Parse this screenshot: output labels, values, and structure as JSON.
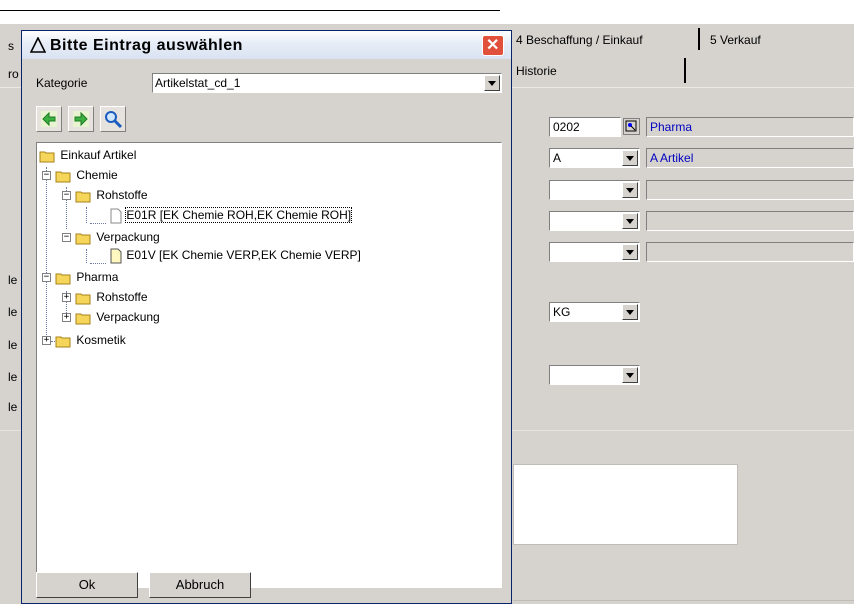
{
  "background": {
    "tabs": [
      {
        "label": "4 Beschaffung / Einkauf"
      },
      {
        "label": "5 Verkauf"
      },
      {
        "label": "Historie"
      }
    ],
    "left_fragments": [
      "s",
      "ro",
      "le",
      "le",
      "le",
      "le",
      "le"
    ],
    "rows": [
      {
        "code": "0202",
        "desc": "Pharma"
      },
      {
        "code": "A",
        "desc": "A Artikel"
      },
      {
        "code": "",
        "desc": ""
      },
      {
        "code": "",
        "desc": ""
      },
      {
        "code": "",
        "desc": ""
      }
    ],
    "unit_value": "KG",
    "empty_combo_value": ""
  },
  "dialog": {
    "title": "Bitte Eintrag auswählen",
    "category_label": "Kategorie",
    "category_value": "Artikelstat_cd_1",
    "toolbar": [
      {
        "icon": "expand-arrow-icon"
      },
      {
        "icon": "collapse-arrow-icon"
      },
      {
        "icon": "search-magnifier-icon"
      }
    ],
    "tree": {
      "root": "Einkauf Artikel",
      "chemie": "Chemie",
      "chemie_rohstoffe": "Rohstoffe",
      "e01r": "E01R [EK Chemie ROH,EK Chemie ROH]",
      "chemie_verpackung": "Verpackung",
      "e01v": "E01V [EK Chemie VERP,EK Chemie VERP]",
      "pharma": "Pharma",
      "pharma_rohstoffe": "Rohstoffe",
      "pharma_verpackung": "Verpackung",
      "kosmetik": "Kosmetik"
    },
    "ok_label": "Ok",
    "cancel_label": "Abbruch"
  },
  "colors": {
    "accent_blue": "#0000c0",
    "close_red": "#e0503a",
    "title_border": "#0a246a"
  }
}
